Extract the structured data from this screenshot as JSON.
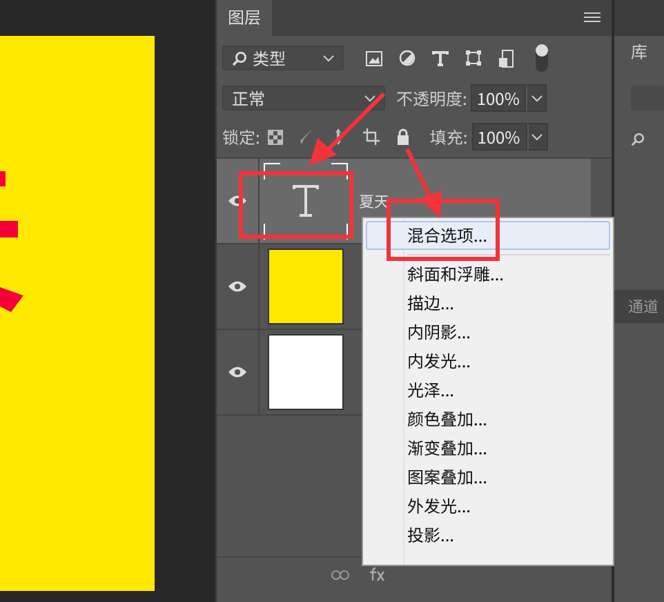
{
  "panel": {
    "tab": {
      "label": "图层",
      "selected": true
    }
  },
  "filter": {
    "value": "类型",
    "toggle_on": true
  },
  "blend": {
    "value": "正常"
  },
  "opacity": {
    "label": "不透明度:",
    "value": "100%"
  },
  "lock": {
    "label": "锁定:"
  },
  "fill": {
    "label": "填充:",
    "value": "100%"
  },
  "layers": [
    {
      "name": "夏天",
      "kind": "text",
      "visible": true,
      "selected": true
    },
    {
      "kind": "yellow",
      "visible": true,
      "selected": false
    },
    {
      "kind": "white",
      "visible": true,
      "selected": false
    }
  ],
  "context_menu": {
    "items": [
      {
        "kind": "item",
        "label": "混合选项...",
        "selected": true
      },
      {
        "kind": "separator"
      },
      {
        "kind": "item",
        "label": "斜面和浮雕...",
        "selected": false
      },
      {
        "kind": "item",
        "label": "描边...",
        "selected": false
      },
      {
        "kind": "item",
        "label": "内阴影...",
        "selected": false
      },
      {
        "kind": "item",
        "label": "内发光...",
        "selected": false
      },
      {
        "kind": "item",
        "label": "光泽...",
        "selected": false
      },
      {
        "kind": "item",
        "label": "颜色叠加...",
        "selected": false
      },
      {
        "kind": "item",
        "label": "渐变叠加...",
        "selected": false
      },
      {
        "kind": "item",
        "label": "图案叠加...",
        "selected": false
      },
      {
        "kind": "item",
        "label": "外发光...",
        "selected": false
      },
      {
        "kind": "item",
        "label": "投影...",
        "selected": false
      }
    ]
  },
  "side_panel": {
    "tabs": [
      {
        "label": "库"
      },
      {
        "label": "通道"
      }
    ]
  }
}
